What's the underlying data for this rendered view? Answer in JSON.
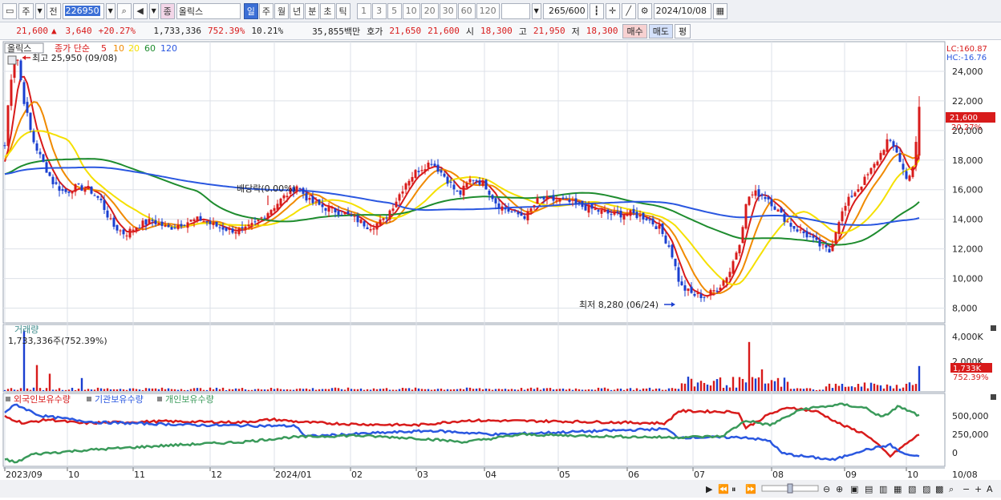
{
  "toolbar": {
    "period_label": "주",
    "prev_label": "전",
    "stock_code": "226950",
    "stock_name": "올릭스",
    "badge_label": "종",
    "periods": [
      "일",
      "주",
      "월",
      "년",
      "분",
      "초",
      "틱"
    ],
    "active_period": "일",
    "minute_options": [
      "1",
      "3",
      "5",
      "10",
      "20",
      "30",
      "60",
      "120"
    ],
    "range_display": "265/600",
    "date": "2024/10/08"
  },
  "quote": {
    "price": "21,600",
    "change_arrow": "▲",
    "change": "3,640",
    "change_pct": "+20.27%",
    "volume": "1,733,336",
    "volume_pct": "752.39%",
    "turnover_pct": "10.21%",
    "amount": "35,855백만",
    "hoga_label": "호가",
    "ask": "21,650",
    "bid": "21,600",
    "open_label": "시",
    "open": "18,300",
    "high_label": "고",
    "high": "21,950",
    "low_label": "저",
    "low": "18,300",
    "buy_label": "매수",
    "sell_label": "매도",
    "avg_label": "평"
  },
  "price_panel": {
    "stock_label": "올릭스",
    "ma_title": "종가 단순",
    "ma_periods": [
      "5",
      "10",
      "20",
      "60",
      "120"
    ],
    "ma_colors": [
      "#d81b1b",
      "#f08a00",
      "#f5e000",
      "#1e8c2e",
      "#2a57e0"
    ],
    "lc_label": "LC:160.87",
    "hc_label": "HC:-16.76",
    "y_ticks": [
      "24,000",
      "22,000",
      "20,000",
      "18,000",
      "16,000",
      "14,000",
      "12,000",
      "10,000",
      "8,000"
    ],
    "current_price": "21,600",
    "current_pct": "20.27%",
    "high_annotation": "최고 25,950 (09/08)",
    "low_annotation": "최저 8,280 (06/24)",
    "dividend_annotation": "배당락(0.00%)"
  },
  "volume_panel": {
    "title": "거래량",
    "value_label": "1,733,336주(752.39%)",
    "y_ticks": [
      "4,000K",
      "2,000K"
    ],
    "current_volume": "1,733K",
    "current_pct": "752.39%"
  },
  "holding_panel": {
    "legend": [
      "외국인보유수량",
      "기관보유수량",
      "개인보유수량"
    ],
    "colors": [
      "#d81b1b",
      "#2a57e0",
      "#3a9a5a"
    ],
    "y_ticks": [
      "500,000",
      "250,000",
      "0"
    ]
  },
  "x_axis": {
    "labels": [
      "2023/09",
      "10",
      "11",
      "12",
      "2024/01",
      "02",
      "03",
      "04",
      "05",
      "06",
      "07",
      "08",
      "09",
      "10",
      "10/08"
    ]
  },
  "colors": {
    "up": "#d81b1b",
    "down": "#1a3fd0",
    "grid": "#dde1e8"
  },
  "chart_data": [
    {
      "type": "candlestick",
      "title": "올릭스",
      "x": [
        "2023/09",
        "10",
        "11",
        "12",
        "2024/01",
        "02",
        "03",
        "04",
        "05",
        "06",
        "07",
        "08",
        "09",
        "10"
      ],
      "ylim": [
        7000,
        26000
      ],
      "close_approx": [
        23500,
        15800,
        13200,
        13600,
        16000,
        14000,
        16800,
        15000,
        14800,
        9000,
        15000,
        12200,
        19500,
        21600
      ],
      "annotations": [
        "최고 25,950 (09/08)",
        "최저 8,280 (06/24)",
        "배당락(0.00%)"
      ]
    },
    {
      "type": "bar",
      "title": "거래량",
      "ylim": [
        0,
        4500000
      ],
      "last_value": 1733336
    },
    {
      "type": "line",
      "series": [
        {
          "name": "외국인보유수량"
        },
        {
          "name": "기관보유수량"
        },
        {
          "name": "개인보유수량"
        }
      ],
      "ylim": [
        -50000,
        700000
      ]
    }
  ]
}
